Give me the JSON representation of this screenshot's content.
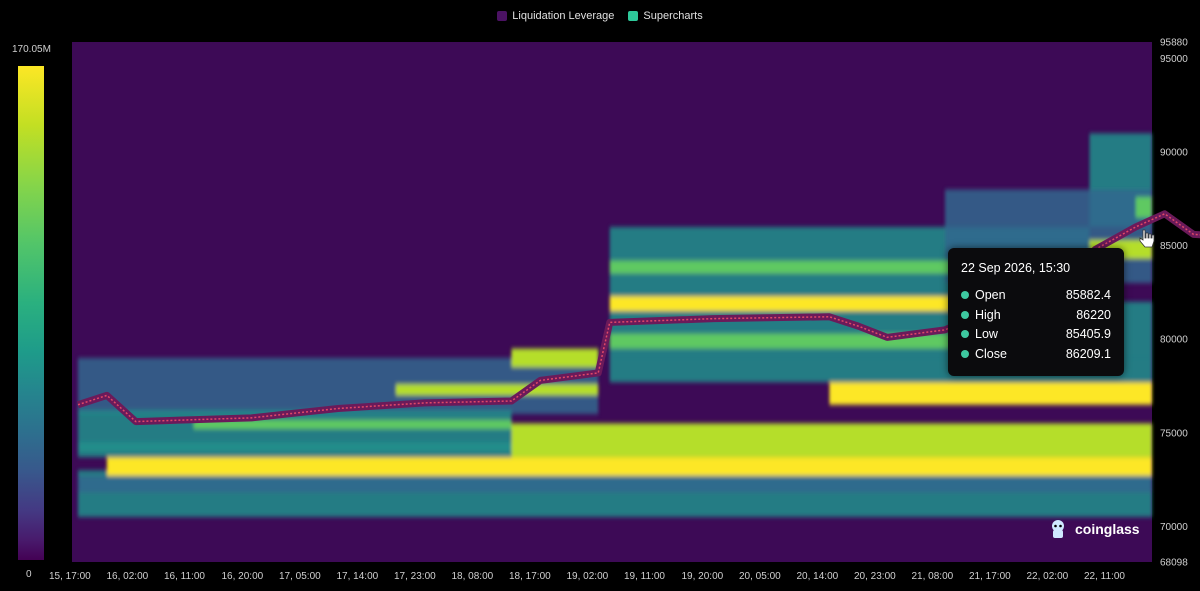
{
  "legend": [
    {
      "label": "Liquidation Leverage",
      "color": "#4b1263"
    },
    {
      "label": "Supercharts",
      "color": "#2ec99a"
    }
  ],
  "colorbar": {
    "max_label": "170.05M",
    "min_label": "0"
  },
  "tooltip": {
    "date": "22 Sep 2026, 15:30",
    "rows": [
      {
        "label": "Open",
        "value": "85882.4"
      },
      {
        "label": "High",
        "value": "86220"
      },
      {
        "label": "Low",
        "value": "85405.9"
      },
      {
        "label": "Close",
        "value": "86209.1"
      }
    ]
  },
  "logo": {
    "text": "coinglass",
    "icon": "coinglass-icon"
  },
  "chart_data": {
    "type": "heatmap",
    "x_tick_labels": [
      "15, 17:00",
      "16, 02:00",
      "16, 11:00",
      "16, 20:00",
      "17, 05:00",
      "17, 14:00",
      "17, 23:00",
      "18, 08:00",
      "18, 17:00",
      "19, 02:00",
      "19, 11:00",
      "19, 20:00",
      "20, 05:00",
      "20, 14:00",
      "20, 23:00",
      "21, 08:00",
      "21, 17:00",
      "22, 02:00",
      "22, 11:00"
    ],
    "y_tick_labels": [
      "95880",
      "95000",
      "90000",
      "85000",
      "80000",
      "75000",
      "70000",
      "68098"
    ],
    "y_ticks": [
      95880,
      95000,
      90000,
      85000,
      80000,
      75000,
      70000,
      68098
    ],
    "ylim": [
      68098,
      95880
    ],
    "colorbar_range": [
      0,
      170050000
    ],
    "price_path": [
      {
        "x": 0.0,
        "y": 76500
      },
      {
        "x": 0.5,
        "y": 77000
      },
      {
        "x": 1.0,
        "y": 75600
      },
      {
        "x": 3.0,
        "y": 75800
      },
      {
        "x": 4.5,
        "y": 76300
      },
      {
        "x": 6.0,
        "y": 76600
      },
      {
        "x": 7.5,
        "y": 76700
      },
      {
        "x": 8.0,
        "y": 77800
      },
      {
        "x": 9.0,
        "y": 78200
      },
      {
        "x": 9.2,
        "y": 80900
      },
      {
        "x": 11.0,
        "y": 81100
      },
      {
        "x": 13.0,
        "y": 81200
      },
      {
        "x": 13.5,
        "y": 80700
      },
      {
        "x": 14.0,
        "y": 80100
      },
      {
        "x": 15.0,
        "y": 80500
      },
      {
        "x": 15.5,
        "y": 81200
      },
      {
        "x": 16.5,
        "y": 81400
      },
      {
        "x": 17.0,
        "y": 81800
      },
      {
        "x": 17.6,
        "y": 84800
      },
      {
        "x": 18.3,
        "y": 86000
      },
      {
        "x": 18.8,
        "y": 86700
      },
      {
        "x": 19.3,
        "y": 85600
      },
      {
        "x": 20.0,
        "y": 85500
      },
      {
        "x": 20.8,
        "y": 86000
      },
      {
        "x": 21.2,
        "y": 85800
      },
      {
        "x": 21.8,
        "y": 86200
      }
    ],
    "liquidation_bands": [
      {
        "y_low": 72700,
        "y_high": 73700,
        "x_start": 0.5,
        "x_end": 23,
        "intensity": 0.95
      },
      {
        "y_low": 73700,
        "y_high": 75500,
        "x_start": 7.5,
        "x_end": 23,
        "intensity": 0.85
      },
      {
        "y_low": 75200,
        "y_high": 75700,
        "x_start": 2.0,
        "x_end": 7.5,
        "intensity": 0.7
      },
      {
        "y_low": 76500,
        "y_high": 77700,
        "x_start": 13.0,
        "x_end": 23,
        "intensity": 0.9
      },
      {
        "y_low": 77000,
        "y_high": 77600,
        "x_start": 5.5,
        "x_end": 9.0,
        "intensity": 0.85
      },
      {
        "y_low": 78500,
        "y_high": 79500,
        "x_start": 7.5,
        "x_end": 9.0,
        "intensity": 0.85
      },
      {
        "y_low": 79500,
        "y_high": 80300,
        "x_start": 9.2,
        "x_end": 16.0,
        "intensity": 0.7
      },
      {
        "y_low": 81500,
        "y_high": 82300,
        "x_start": 9.2,
        "x_end": 18.0,
        "intensity": 0.9
      },
      {
        "y_low": 83500,
        "y_high": 84200,
        "x_start": 9.2,
        "x_end": 18.0,
        "intensity": 0.55
      },
      {
        "y_low": 84300,
        "y_high": 85300,
        "x_start": 17.5,
        "x_end": 23,
        "intensity": 0.8
      },
      {
        "y_low": 86500,
        "y_high": 87600,
        "x_start": 18.3,
        "x_end": 23,
        "intensity": 0.7
      },
      {
        "y_low": 88000,
        "y_high": 89000,
        "x_start": 19.5,
        "x_end": 23,
        "intensity": 0.6
      },
      {
        "y_low": 89000,
        "y_high": 89700,
        "x_start": 20.5,
        "x_end": 23,
        "intensity": 0.9
      }
    ]
  }
}
